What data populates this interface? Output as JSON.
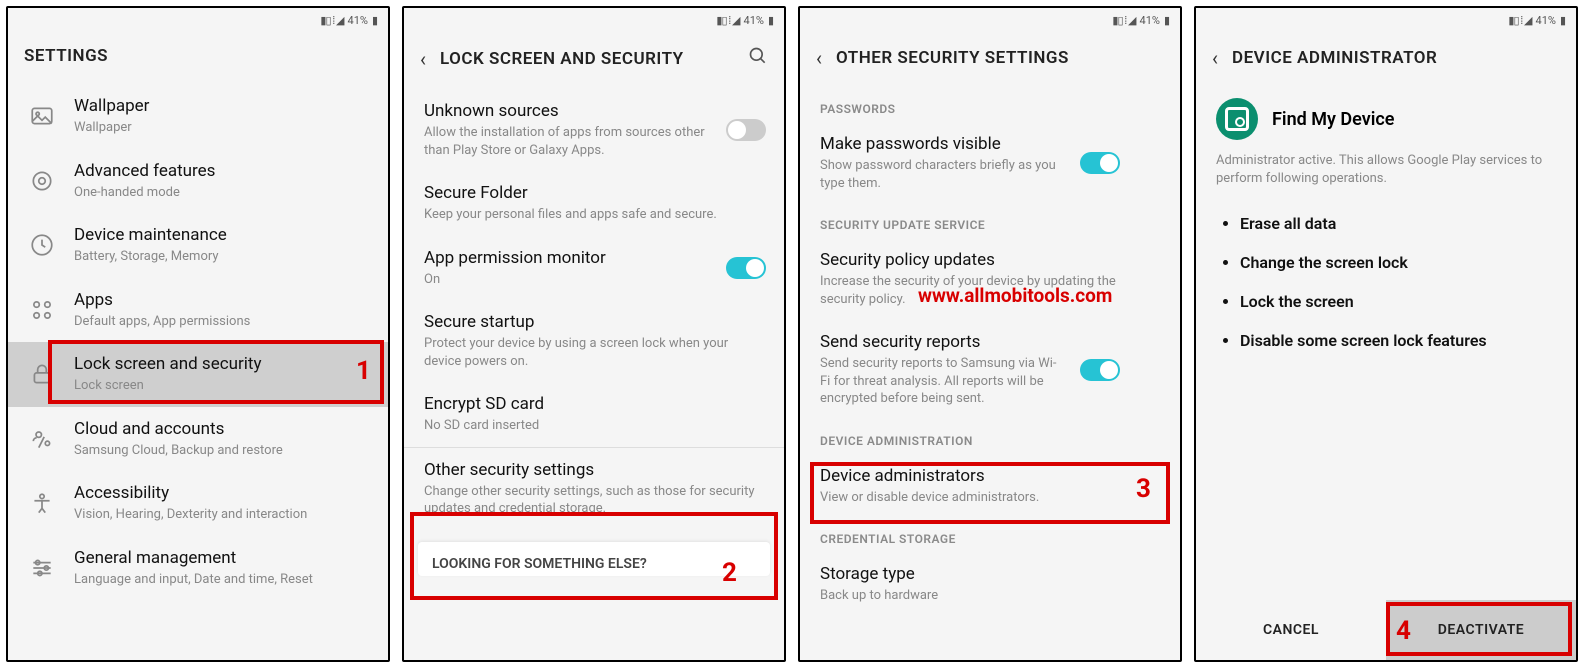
{
  "statusbar": {
    "battery": "41%"
  },
  "watermark": "www.allmobitools.com",
  "panel1": {
    "title": "SETTINGS",
    "items": [
      {
        "title": "Wallpaper",
        "sub": "Wallpaper"
      },
      {
        "title": "Advanced features",
        "sub": "One-handed mode"
      },
      {
        "title": "Device maintenance",
        "sub": "Battery, Storage, Memory"
      },
      {
        "title": "Apps",
        "sub": "Default apps, App permissions"
      },
      {
        "title": "Lock screen and security",
        "sub": "Lock screen"
      },
      {
        "title": "Cloud and accounts",
        "sub": "Samsung Cloud, Backup and restore"
      },
      {
        "title": "Accessibility",
        "sub": "Vision, Hearing, Dexterity and interaction"
      },
      {
        "title": "General management",
        "sub": "Language and input, Date and time, Reset"
      }
    ],
    "step_num": "1"
  },
  "panel2": {
    "title": "LOCK SCREEN AND SECURITY",
    "items": [
      {
        "title": "Unknown sources",
        "sub": "Allow the installation of apps from sources other than Play Store or Galaxy Apps.",
        "toggle": "off"
      },
      {
        "title": "Secure Folder",
        "sub": "Keep your personal files and apps safe and secure."
      },
      {
        "title": "App permission monitor",
        "sub": "On",
        "toggle": "on"
      },
      {
        "title": "Secure startup",
        "sub": "Protect your device by using a screen lock when your device powers on."
      },
      {
        "title": "Encrypt SD card",
        "sub": "No SD card inserted"
      },
      {
        "title": "Other security settings",
        "sub": "Change other security settings, such as those for security updates and credential storage."
      }
    ],
    "lookfor": "LOOKING FOR SOMETHING ELSE?",
    "step_num": "2"
  },
  "panel3": {
    "title": "OTHER SECURITY SETTINGS",
    "sec_passwords": "PASSWORDS",
    "item_pass": {
      "title": "Make passwords visible",
      "sub": "Show password characters briefly as you type them."
    },
    "sec_update": "SECURITY UPDATE SERVICE",
    "item_policy": {
      "title": "Security policy updates",
      "sub": "Increase the security of your device by updating the security policy."
    },
    "item_reports": {
      "title": "Send security reports",
      "sub": "Send security reports to Samsung via Wi-Fi for threat analysis. All reports will be encrypted before being sent."
    },
    "sec_admin": "DEVICE ADMINISTRATION",
    "item_admin": {
      "title": "Device administrators",
      "sub": "View or disable device administrators."
    },
    "sec_cred": "CREDENTIAL STORAGE",
    "item_storage": {
      "title": "Storage type",
      "sub": "Back up to hardware"
    },
    "step_num": "3"
  },
  "panel4": {
    "title": "DEVICE ADMINISTRATOR",
    "app": "Find My Device",
    "desc": "Administrator active. This allows Google Play services to perform following operations.",
    "bullets": [
      "Erase all data",
      "Change the screen lock",
      "Lock the screen",
      "Disable some screen lock features"
    ],
    "cancel": "CANCEL",
    "deactivate": "DEACTIVATE",
    "step_num": "4"
  }
}
